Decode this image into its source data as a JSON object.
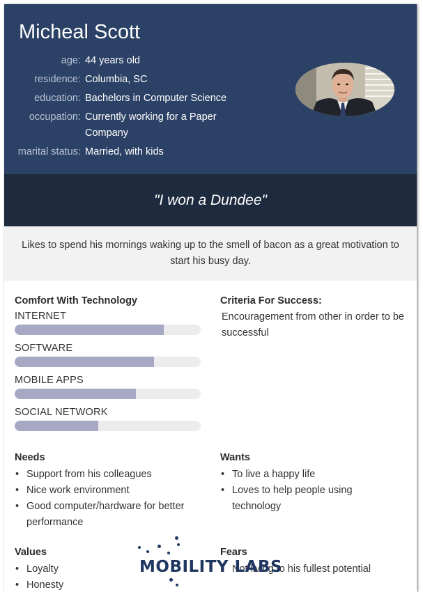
{
  "persona": {
    "name": "Micheal Scott",
    "facts": [
      {
        "key": "age:",
        "value": "44 years old"
      },
      {
        "key": "residence:",
        "value": "Columbia, SC"
      },
      {
        "key": "education:",
        "value": "Bachelors in Computer Science"
      },
      {
        "key": "occupation:",
        "value": "Currently working for a Paper Company"
      },
      {
        "key": "marital status:",
        "value": "Married, with kids"
      }
    ],
    "quote": "\"I won a Dundee\"",
    "intro": "Likes to spend his mornings waking up to the smell of bacon as a great motivation to start his busy day."
  },
  "comfort": {
    "title": "Comfort With Technology",
    "items": [
      {
        "label": "INTERNET",
        "level": 0.8
      },
      {
        "label": "SOFTWARE",
        "level": 0.75
      },
      {
        "label": "MOBILE APPS",
        "level": 0.65
      },
      {
        "label": "SOCIAL NETWORK",
        "level": 0.45
      }
    ]
  },
  "criteria": {
    "title": "Criteria For Success:",
    "text": "Encouragement from other in order to be successful"
  },
  "needs": {
    "title": "Needs",
    "items": [
      "Support from his colleagues",
      "Nice work environment",
      "Good computer/hardware for better performance"
    ]
  },
  "wants": {
    "title": "Wants",
    "items": [
      "To live a happy life",
      "Loves to help people using technology"
    ]
  },
  "values": {
    "title": "Values",
    "items": [
      "Loyalty",
      "Honesty"
    ]
  },
  "fears": {
    "title": "Fears",
    "items": [
      "Not living to his fullest potential"
    ]
  },
  "logo": {
    "text": "MOBILITY LABS"
  },
  "colors": {
    "header": "#2c4166",
    "quote_band": "#1e2b3f",
    "meter_fill": "#a7a8c4",
    "meter_track": "#ececef"
  }
}
